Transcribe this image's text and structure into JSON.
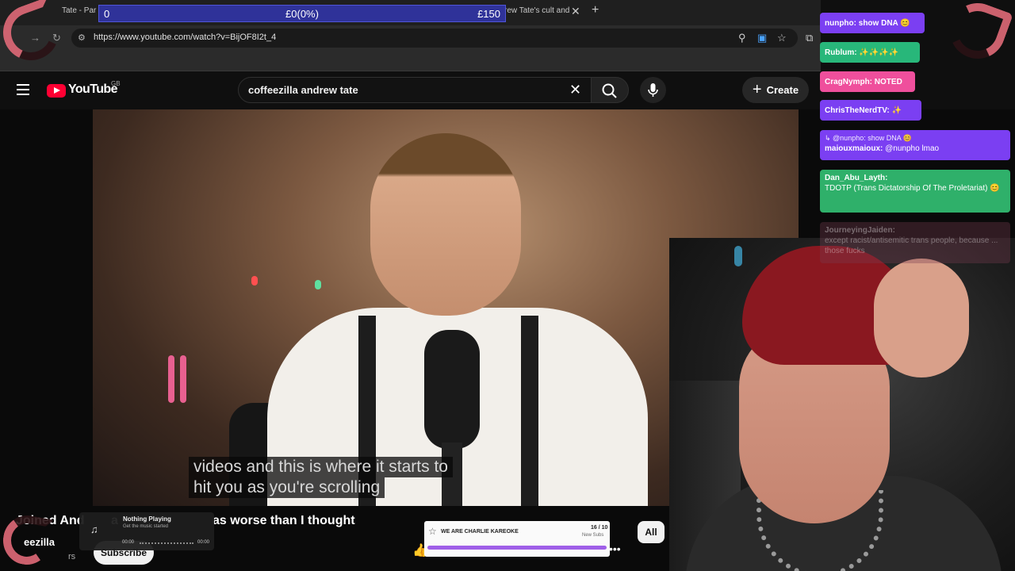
{
  "browser": {
    "tab_left_label": "Tate - Par",
    "tab_right_label": "rew Tate's cult and",
    "url": "https://www.youtube.com/watch?v=BijOF8I2t_4"
  },
  "donation_bar": {
    "current": "0",
    "progress": "£0(0%)",
    "goal": "£150"
  },
  "youtube": {
    "logo_text": "YouTube",
    "region": "GB",
    "search_query": "coffeezilla andrew tate",
    "create_label": "Create"
  },
  "video": {
    "caption_lines": [
      "videos and this is where it starts to",
      "hit you as you're scrolling"
    ]
  },
  "below_video": {
    "title_left": "Joined And",
    "title_left_suffix": "a",
    "title_right": "as worse than I thought",
    "channel": "eezilla",
    "subs": "rs",
    "subscribe_label": "Subscribe",
    "filter_chip": "All"
  },
  "music_widget": {
    "title": "Nothing Playing",
    "subtitle": "Get the music started",
    "time_start": "00:00",
    "time_end": "00:00"
  },
  "sub_goal": {
    "title": "WE ARE CHARLIE KAREOKE",
    "count": "16 / 10",
    "label": "New Subs",
    "fill_fraction": 1.0
  },
  "chat": {
    "messages": [
      {
        "user": "nunpho:",
        "text": "show DNA 😊"
      },
      {
        "user": "Rublum:",
        "text": "✨✨✨✨"
      },
      {
        "user": "CragNymph:",
        "text": "NOTED"
      },
      {
        "user": "ChrisTheNerdTV:",
        "text": "✨"
      },
      {
        "reply": "↳ @nunpho: show DNA 😊",
        "user": "maiouxmaioux:",
        "text": "@nunpho lmao"
      },
      {
        "user": "Dan_Abu_Layth:",
        "text": "TDOTP (Trans Dictatorship Of The Proletariat) 😊"
      },
      {
        "user": "JourneyingJaiden:",
        "text": "except racist/antisemitic trans people, because ... those fucks"
      }
    ]
  },
  "colors": {
    "donation_bar": "#2f3299",
    "youtube_red": "#ff0033",
    "chat_purple": "#7b3ff2",
    "chat_green": "#28b77a",
    "chat_pink": "#ef4f9c",
    "goal_fill": "#9f5fe8"
  }
}
